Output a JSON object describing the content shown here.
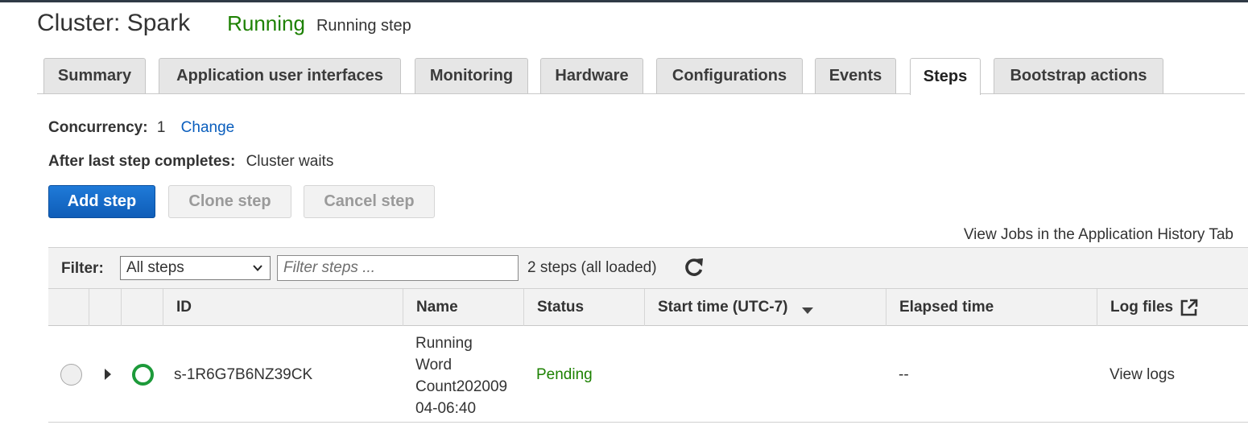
{
  "header": {
    "title": "Cluster: Spark",
    "state": "Running",
    "substate": "Running step"
  },
  "tabs": [
    {
      "label": "Summary",
      "active": false
    },
    {
      "label": "Application user interfaces",
      "active": false
    },
    {
      "label": "Monitoring",
      "active": false
    },
    {
      "label": "Hardware",
      "active": false
    },
    {
      "label": "Configurations",
      "active": false
    },
    {
      "label": "Events",
      "active": false
    },
    {
      "label": "Steps",
      "active": true
    },
    {
      "label": "Bootstrap actions",
      "active": false
    }
  ],
  "concurrency": {
    "label": "Concurrency:",
    "value": "1",
    "change_link": "Change"
  },
  "after_last_step": {
    "label": "After last step completes:",
    "value": "Cluster waits"
  },
  "actions": {
    "add_step": "Add step",
    "clone_step": "Clone step",
    "cancel_step": "Cancel step"
  },
  "history_link": "View Jobs in the Application History Tab",
  "filter": {
    "label": "Filter:",
    "selected": "All steps",
    "placeholder": "Filter steps ...",
    "count": "2 steps (all loaded)"
  },
  "table": {
    "columns": [
      "ID",
      "Name",
      "Status",
      "Start time (UTC-7)",
      "Elapsed time",
      "Log files"
    ],
    "rows": [
      {
        "id": "s-1R6G7B6NZ39CK",
        "name_lines": [
          "Running",
          "Word",
          "Count202009",
          "04-06:40"
        ],
        "status": "Pending",
        "start_time": "",
        "elapsed": "--",
        "logs": "View logs"
      }
    ]
  },
  "colors": {
    "running": "#1d8102",
    "link": "#0a5ebd",
    "primary": "#1f7ad8"
  },
  "icons": [
    "chevron-down-icon",
    "refresh-icon",
    "sort-down-icon",
    "external-link-icon",
    "expand-caret-icon",
    "status-pending-icon"
  ]
}
